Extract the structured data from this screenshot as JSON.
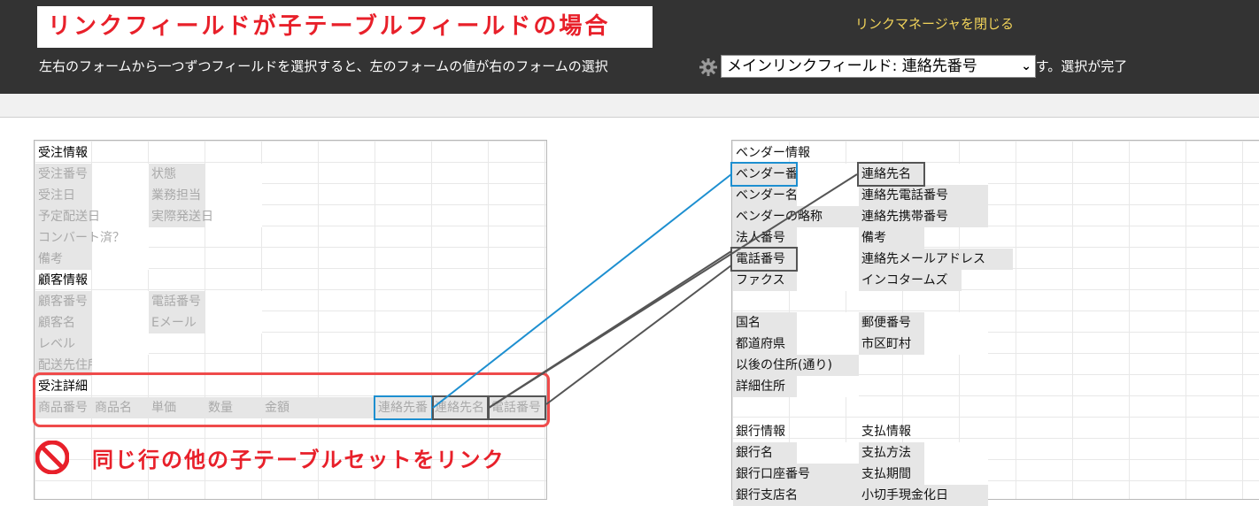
{
  "header": {
    "title": "リンクフィールドが子テーブルフィールドの場合",
    "close_label": "リンクマネージャを閉じる",
    "instructions_before": "左右のフォームから一つずつフィールドを選択すると、左のフォームの値が右のフォームの選択",
    "instructions_after": "むようになります。選択が完了",
    "select_value": "メインリンクフィールド: 連絡先番号",
    "select_icon": "chevron-down-icon",
    "settings_icon": "gear-icon"
  },
  "left_form": {
    "section1": "受注情報",
    "order_no": "受注番号",
    "status": "状態",
    "order_date": "受注日",
    "staff": "業務担当",
    "planned_ship": "予定配送日",
    "actual_ship": "実際発送日",
    "converted": "コンバート済？",
    "notes": "備考",
    "section2": "顧客情報",
    "customer_no": "顧客番号",
    "phone": "電話番号",
    "customer_name": "顧客名",
    "email": "Eメール",
    "level": "レベル",
    "ship_address": "配送先住所",
    "section3": "受注詳細",
    "table_headers": [
      "商品番号",
      "商品名",
      "単価",
      "数量",
      "金額"
    ],
    "linked_headers": [
      "連絡先番",
      "連絡先名",
      "電話番号"
    ]
  },
  "right_form": {
    "section1": "ベンダー情報",
    "vendor_no": "ベンダー番号",
    "contact_name": "連絡先名",
    "vendor_name": "ベンダー名",
    "contact_phone": "連絡先電話番号",
    "vendor_short": "ベンダーの略称",
    "contact_mobile": "連絡先携帯番号",
    "corp_no": "法人番号",
    "notes": "備考",
    "phone": "電話番号",
    "contact_email": "連絡先メールアドレス",
    "fax": "ファクス",
    "incoterms": "インコタームズ",
    "country": "国名",
    "postal": "郵便番号",
    "prefecture": "都道府県",
    "city": "市区町村",
    "street": "以後の住所(通り)",
    "detail_address": "詳細住所",
    "bank_info": "銀行情報",
    "payment_info": "支払情報",
    "bank_name": "銀行名",
    "payment_method": "支払方法",
    "bank_account": "銀行口座番号",
    "payment_term": "支払期間",
    "bank_branch": "銀行支店名",
    "check_day": "小切手現金化日"
  },
  "warning": {
    "icon": "no-entry-icon",
    "text": "同じ行の他の子テーブルセットをリンク"
  },
  "colors": {
    "accent_red": "#e8202a",
    "link_blue": "#1d8fd0",
    "link_grey": "#555555",
    "close_yellow": "#f1d35a"
  }
}
